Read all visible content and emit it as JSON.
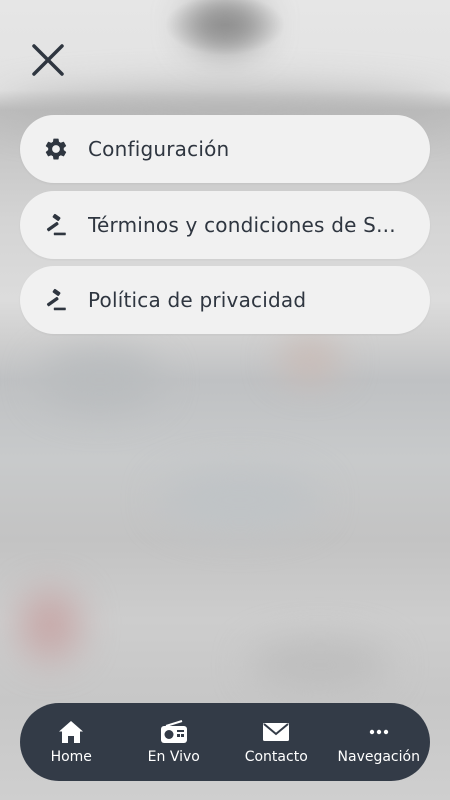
{
  "menu": {
    "close_icon": "close-icon",
    "items": [
      {
        "label": "Configuración",
        "icon": "gear-icon"
      },
      {
        "label": "Términos y condiciones de S...",
        "icon": "gavel-icon"
      },
      {
        "label": "Política de privacidad",
        "icon": "gavel-icon"
      }
    ]
  },
  "bottom_nav": {
    "items": [
      {
        "label": "Home",
        "icon": "home-icon"
      },
      {
        "label": "En Vivo",
        "icon": "radio-icon"
      },
      {
        "label": "Contacto",
        "icon": "mail-icon"
      },
      {
        "label": "Navegación",
        "icon": "more-icon"
      }
    ]
  },
  "colors": {
    "menu_item_bg": "#f1f1f1",
    "text": "#2f3640",
    "nav_bg": "#333b47",
    "nav_text": "#ffffff"
  }
}
